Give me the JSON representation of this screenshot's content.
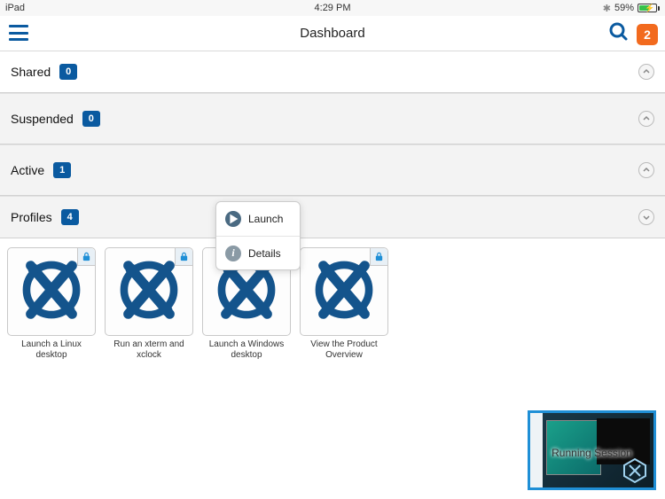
{
  "status": {
    "device": "iPad",
    "time": "4:29 PM",
    "battery_pct": "59%"
  },
  "nav": {
    "title": "Dashboard",
    "badge_count": "2"
  },
  "sections": {
    "shared": {
      "title": "Shared",
      "count": "0"
    },
    "suspended": {
      "title": "Suspended",
      "count": "0"
    },
    "active": {
      "title": "Active",
      "count": "1"
    },
    "profiles": {
      "title": "Profiles",
      "count": "4"
    }
  },
  "profiles": [
    {
      "label": "Launch a Linux desktop"
    },
    {
      "label": "Run an xterm and xclock"
    },
    {
      "label": "Launch a Windows desktop"
    },
    {
      "label": "View the Product Overview"
    }
  ],
  "popover": {
    "launch": "Launch",
    "details": "Details"
  },
  "running": {
    "label": "Running Session"
  }
}
